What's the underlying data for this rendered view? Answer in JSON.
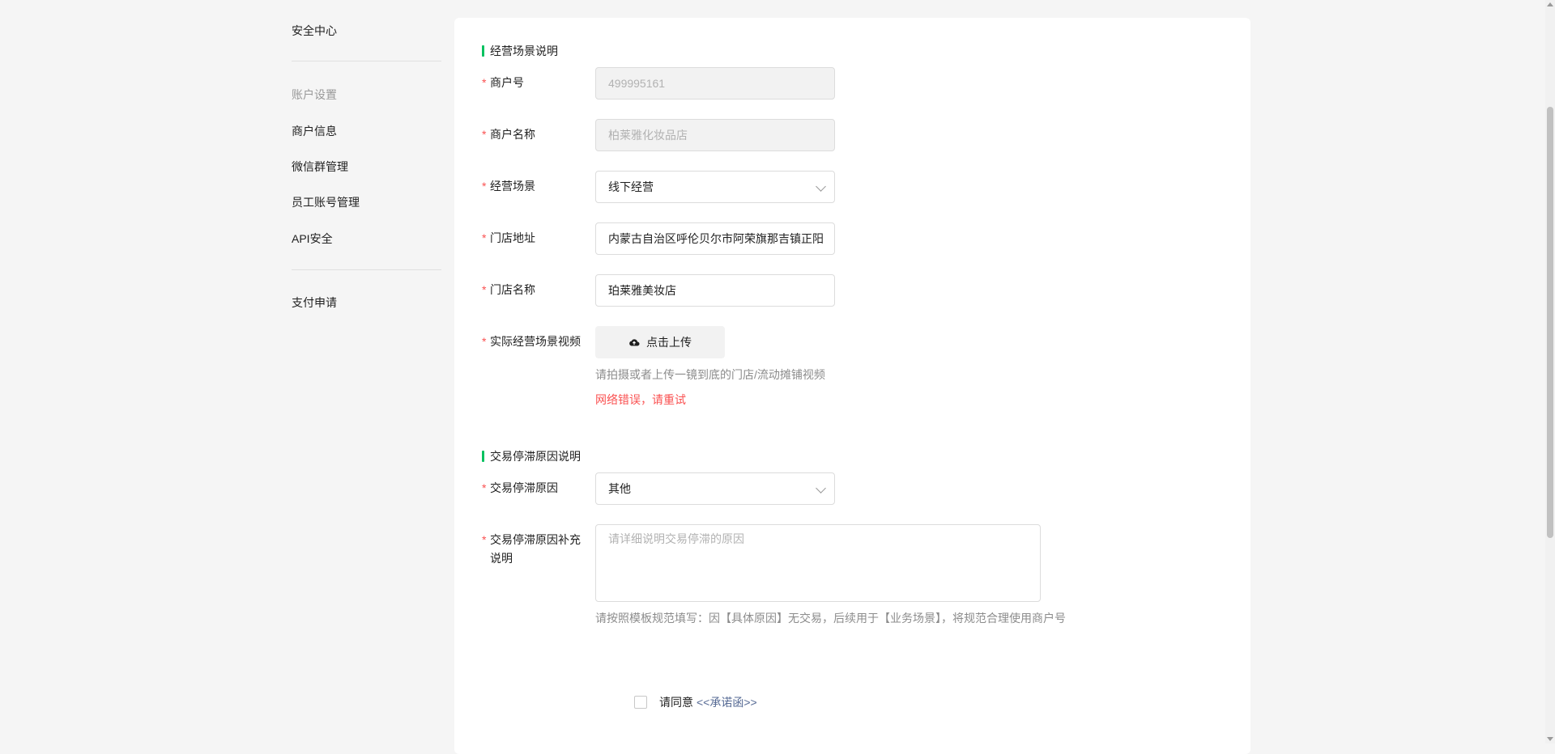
{
  "sidebar": {
    "security_center": "安全中心",
    "group_account": "账户设置",
    "items": [
      {
        "label": "商户信息"
      },
      {
        "label": "微信群管理"
      },
      {
        "label": "员工账号管理"
      },
      {
        "label": "API安全"
      }
    ],
    "pay_apply": "支付申请"
  },
  "sections": {
    "business": "经营场景说明",
    "stagnation": "交易停滞原因说明"
  },
  "form": {
    "required_mark": "*",
    "merchant_id": {
      "label": "商户号",
      "value": "499995161"
    },
    "merchant_name": {
      "label": "商户名称",
      "value": "柏莱雅化妆品店"
    },
    "business_scene": {
      "label": "经营场景",
      "value": "线下经营"
    },
    "store_address": {
      "label": "门店地址",
      "value": "内蒙古自治区呼伦贝尔市阿荣旗那吉镇正阳"
    },
    "store_name": {
      "label": "门店名称",
      "value": "珀莱雅美妆店"
    },
    "video": {
      "label": "实际经营场景视频",
      "button": "点击上传",
      "hint": "请拍摄或者上传一镜到底的门店/流动摊铺视频",
      "error": "网络错误，请重试"
    },
    "stagnation_reason": {
      "label": "交易停滞原因",
      "value": "其他"
    },
    "stagnation_detail": {
      "label_line1": "交易停滞原因补充",
      "label_line2": "说明",
      "placeholder": "请详细说明交易停滞的原因",
      "hint": "请按照模板规范填写：因【具体原因】无交易，后续用于【业务场景】，将规范合理使用商户号"
    }
  },
  "agreement": {
    "prefix": "请同意",
    "link": "<<承诺函>>"
  },
  "colors": {
    "accent_green": "#07c160",
    "required_red": "#fa5151",
    "link_blue": "#576b95"
  }
}
